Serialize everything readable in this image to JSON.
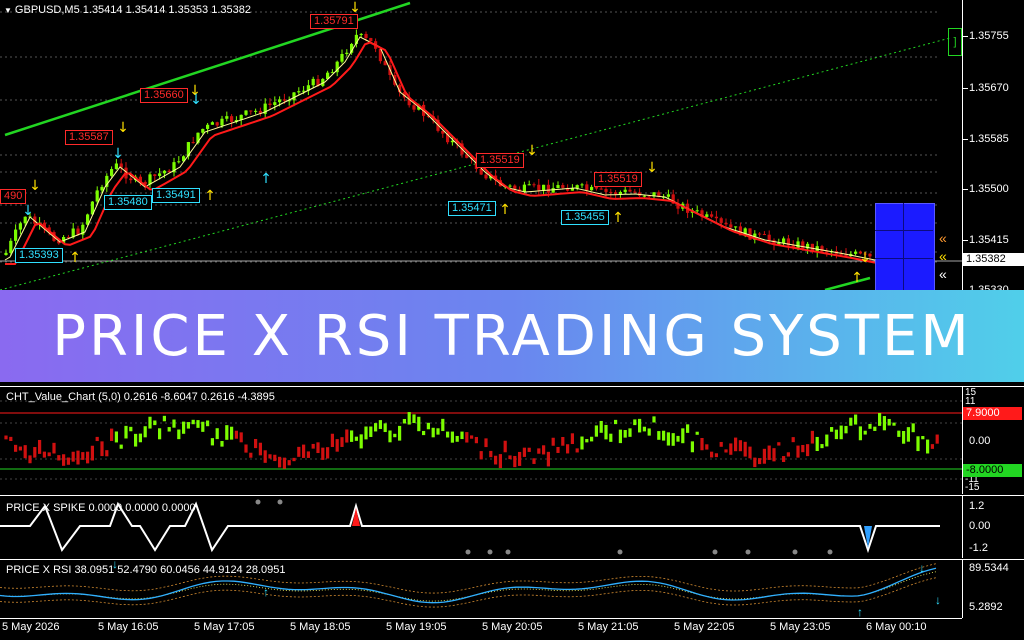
{
  "main": {
    "symbol_header": "GBPUSD,M5  1.35414  1.35414  1.35353  1.35382",
    "price_ticks": [
      "1.35755",
      "1.35670",
      "1.35585",
      "1.35500",
      "1.35415",
      "1.35330"
    ],
    "current_price": "1.35382",
    "labels": [
      {
        "text": "1.35791",
        "kind": "red"
      },
      {
        "text": "1.35660",
        "kind": "red"
      },
      {
        "text": "1.35587",
        "kind": "red"
      },
      {
        "text": "490",
        "kind": "red"
      },
      {
        "text": "1.35519",
        "kind": "red"
      },
      {
        "text": "1.35519",
        "kind": "red"
      },
      {
        "text": "1.35491",
        "kind": "cyan"
      },
      {
        "text": "1.35480",
        "kind": "cyan"
      },
      {
        "text": "1.35471",
        "kind": "cyan"
      },
      {
        "text": "1.35455",
        "kind": "cyan"
      },
      {
        "text": "1.35393",
        "kind": "cyan"
      }
    ]
  },
  "banner": {
    "title": "PRICE X RSI TRADING SYSTEM"
  },
  "value_chart": {
    "header": "CHT_Value_Chart (5,0) 0.2616 -8.6047 0.2616 -4.3895",
    "ticks": [
      "15",
      "11",
      "0.00",
      "-11",
      "-15"
    ],
    "upper_level": "7.9000",
    "lower_level": "-8.0000"
  },
  "spike": {
    "header": "PRICE X SPIKE 0.0000 0.0000 0.0000",
    "ticks": [
      "1.2",
      "0.00",
      "-1.2"
    ]
  },
  "rsi": {
    "header": "PRICE X RSI 38.0951 52.4790 60.0456 44.9124 28.0951",
    "ticks": [
      "89.5344",
      "5.2892"
    ]
  },
  "time_axis": [
    "5 May 2026",
    "5 May 16:05",
    "5 May 17:05",
    "5 May 18:05",
    "5 May 19:05",
    "5 May 20:05",
    "5 May 21:05",
    "5 May 22:05",
    "5 May 23:05",
    "6 May 00:10"
  ],
  "colors": {
    "bull": "#7cfc00",
    "bear": "#d01010",
    "ma_red": "#ff1a1a",
    "ma_white": "#ffff99",
    "channel": "#22d622",
    "accent_cyan": "#30e0ff",
    "arrow_yellow": "#ffe000"
  }
}
